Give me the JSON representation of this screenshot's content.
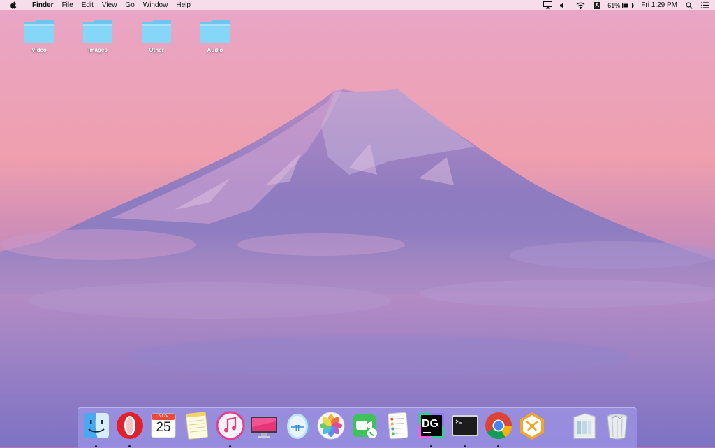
{
  "menubar": {
    "apple_icon": "apple-icon",
    "app_name": "Finder",
    "menus": [
      "File",
      "Edit",
      "View",
      "Go",
      "Window",
      "Help"
    ],
    "status": {
      "airplay_icon": "airplay-icon",
      "volume_icon": "volume-icon",
      "wifi_icon": "wifi-icon",
      "input_source": "A",
      "battery_percent": "61%",
      "battery_level": 0.61,
      "clock": "Fri 1:29 PM",
      "spotlight_icon": "spotlight-search-icon",
      "notification_icon": "notification-center-icon"
    }
  },
  "desktop": {
    "folders": [
      {
        "label": "Video",
        "icon": "folder-icon"
      },
      {
        "label": "Images",
        "icon": "folder-icon"
      },
      {
        "label": "Other",
        "icon": "folder-icon"
      },
      {
        "label": "Audio",
        "icon": "folder-icon"
      }
    ]
  },
  "dock": {
    "apps": [
      {
        "icon": "finder-icon",
        "running": true
      },
      {
        "icon": "opera-icon",
        "running": true
      },
      {
        "icon": "calendar-icon",
        "running": false,
        "month": "NOV",
        "day": "25"
      },
      {
        "icon": "notes-icon",
        "running": false
      },
      {
        "icon": "itunes-icon",
        "running": true
      },
      {
        "icon": "cleanmymac-icon",
        "running": false
      },
      {
        "icon": "translator-icon",
        "running": false
      },
      {
        "icon": "photos-icon",
        "running": false
      },
      {
        "icon": "facetime-icon",
        "running": false
      },
      {
        "icon": "reminders-icon",
        "running": false
      },
      {
        "icon": "datagrip-icon",
        "running": true,
        "text": "DG"
      },
      {
        "icon": "terminal-icon",
        "running": true
      },
      {
        "icon": "chrome-icon",
        "running": true
      },
      {
        "icon": "sequel-hex-icon",
        "running": false
      }
    ],
    "stack_icon": "documents-stack-icon",
    "trash_icon": "trash-icon"
  },
  "colors": {
    "folder": "#7fd3f7",
    "sky_top": "#e8a8c8",
    "sky_bottom": "#7a6fc8",
    "mountain": "#8a78c0",
    "dock_bg": "#a096e6"
  }
}
